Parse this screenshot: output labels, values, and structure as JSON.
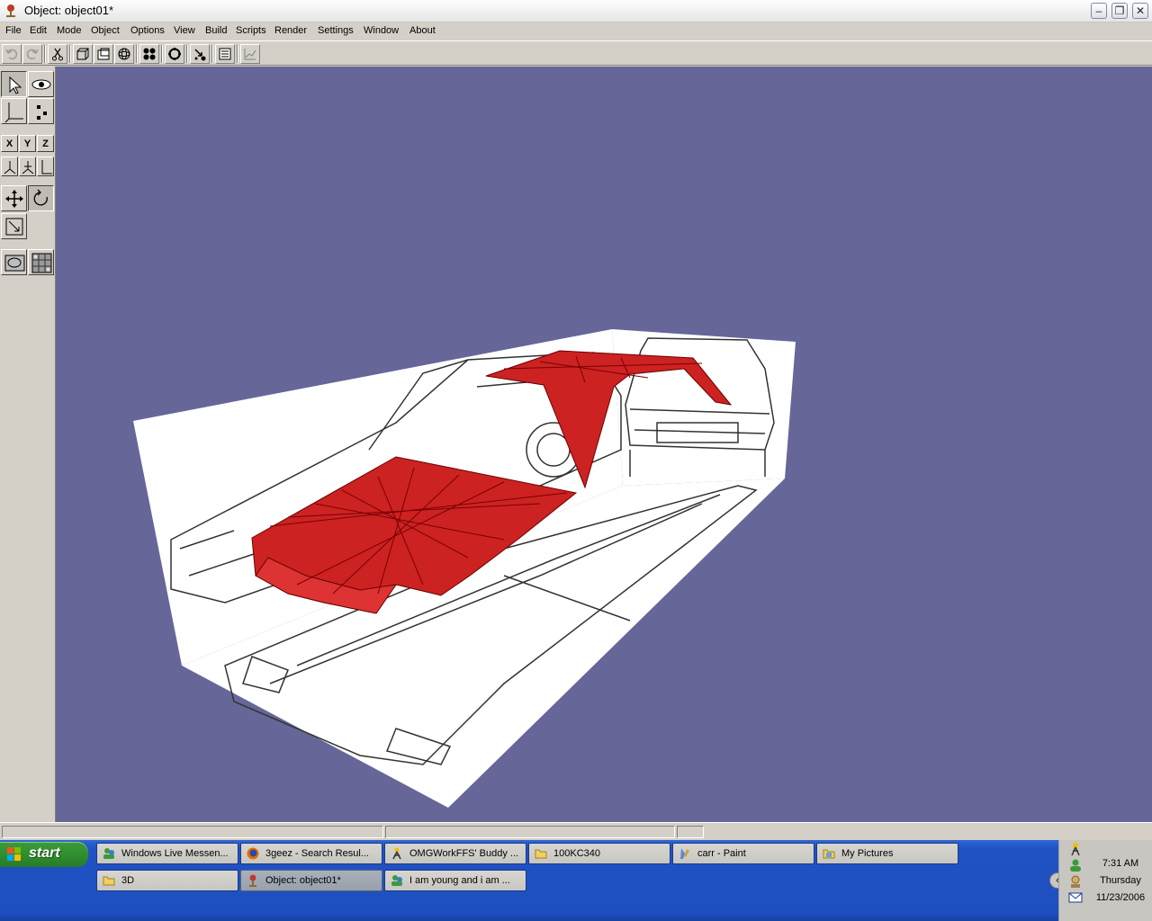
{
  "window": {
    "title": "Object: object01*",
    "icon": "app-3d-icon"
  },
  "menu": [
    "File",
    "Edit",
    "Mode",
    "Object",
    "Options",
    "View",
    "Build",
    "Scripts",
    "Render",
    "Settings",
    "Window",
    "About"
  ],
  "toolbar": {
    "icons": [
      "undo-icon",
      "redo-icon",
      "cut-icon",
      "cube-view-icon",
      "box-view-icon",
      "sphere-view-icon",
      "dots-grid-icon",
      "circle-select-icon",
      "move-points-icon",
      "list-icon",
      "graph-icon"
    ]
  },
  "palette": {
    "icons": [
      "arrow-select-icon",
      "eye-icon",
      "axis-icon",
      "points-icon",
      "axis-x-icon",
      "axis-y-icon",
      "axis-z-icon",
      "axes-a-icon",
      "axes-b-icon",
      "axes-c-icon",
      "move-icon",
      "rotate-icon",
      "scale-icon",
      "render-preview-icon",
      "texture-grid-icon"
    ],
    "axis_labels": {
      "x": "X",
      "y": "Y",
      "z": "Z"
    }
  },
  "viewport": {
    "background": "#666699",
    "model_color": "#cc2222"
  },
  "taskbar": {
    "start_label": "start",
    "tasks_row1": [
      {
        "label": "Windows Live Messen...",
        "icon": "messenger-icon"
      },
      {
        "label": "3geez - Search Resul...",
        "icon": "firefox-icon"
      },
      {
        "label": "OMGWorkFFS' Buddy ...",
        "icon": "aim-icon"
      },
      {
        "label": "100KC340",
        "icon": "folder-icon"
      },
      {
        "label": "carr - Paint",
        "icon": "paint-icon"
      },
      {
        "label": "My Pictures",
        "icon": "folder-pictures-icon"
      }
    ],
    "tasks_row2": [
      {
        "label": "3D",
        "icon": "folder-icon"
      },
      {
        "label": "Object: object01*",
        "icon": "app-3d-icon",
        "active": true
      },
      {
        "label": "I am young and i am ...",
        "icon": "messenger-icon"
      }
    ]
  },
  "tray": {
    "time": "7:31 AM",
    "day": "Thursday",
    "date": "11/23/2006"
  }
}
